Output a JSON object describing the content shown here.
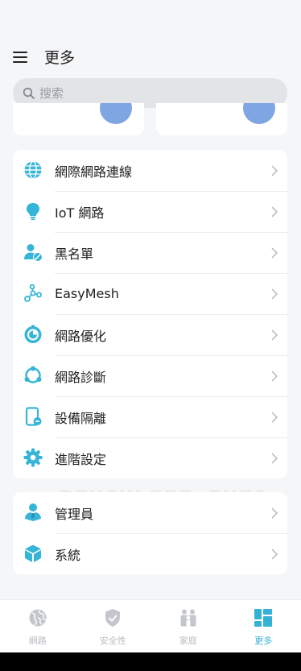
{
  "header": {
    "title": "更多"
  },
  "search": {
    "placeholder": "搜索",
    "value": ""
  },
  "menu_primary": [
    {
      "label": "網際網路連線",
      "icon": "globe-icon"
    },
    {
      "label": "IoT 網路",
      "icon": "lightbulb-icon"
    },
    {
      "label": "黑名單",
      "icon": "user-block-icon"
    },
    {
      "label": "EasyMesh",
      "icon": "mesh-nodes-icon"
    },
    {
      "label": "網路優化",
      "icon": "speed-optimize-icon"
    },
    {
      "label": "網路診斷",
      "icon": "diagnose-icon"
    },
    {
      "label": "設備隔離",
      "icon": "device-isolation-icon"
    },
    {
      "label": "進階設定",
      "icon": "gear-icon"
    }
  ],
  "menu_secondary": [
    {
      "label": "管理員",
      "icon": "admin-icon"
    },
    {
      "label": "系統",
      "icon": "system-cube-icon"
    }
  ],
  "watermark": "BENCHLIFE.INFO",
  "bottom_nav": [
    {
      "label": "網路",
      "icon": "network-globe-icon",
      "active": false
    },
    {
      "label": "安全性",
      "icon": "shield-icon",
      "active": false
    },
    {
      "label": "家庭",
      "icon": "family-icon",
      "active": false
    },
    {
      "label": "更多",
      "icon": "more-grid-icon",
      "active": true
    }
  ],
  "colors": {
    "accent": "#33b2d6",
    "background": "#f5f6f8",
    "card": "#ffffff",
    "inactive": "#c3c6cc"
  }
}
